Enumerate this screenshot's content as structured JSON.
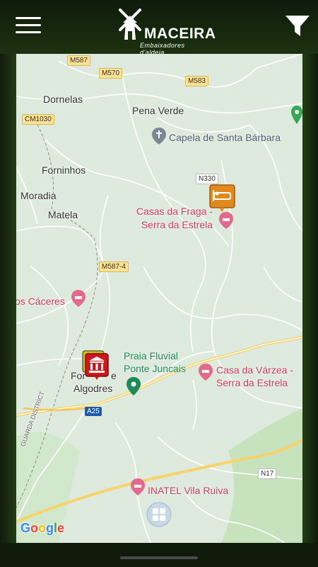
{
  "header": {
    "logo_text": "MACEIRA",
    "logo_subtitle": "Embaixadores d'aldeia",
    "menu_icon": "hamburger-menu-icon",
    "filter_icon": "filter-funnel-icon"
  },
  "map": {
    "places": {
      "dornelas": "Dornelas",
      "pena_verde": "Pena Verde",
      "forninhos": "Forninhos",
      "moradia": "Moradia",
      "matela": "Matela",
      "fornos_top": "For",
      "fornos_mid": "e",
      "algodres": "Algodres",
      "guarda_district": "GUARDA DISTRICT"
    },
    "roads": {
      "m587": "M587",
      "m570": "M570",
      "m583": "M583",
      "cm1030": "CM1030",
      "n330": "N330",
      "m587_4": "M587-4",
      "a25": "A25",
      "n17": "N17"
    },
    "pois": {
      "capela": "Capela de Santa Bárbara",
      "casas_fraga_1": "Casas da Fraga -",
      "casas_fraga_2": "Serra da Estrela",
      "os_caceres": "os Cáceres",
      "praia_1": "Praia Fluvial",
      "praia_2": "Ponte Juncais",
      "casa_varzea_1": "Casa da Várzea -",
      "casa_varzea_2": "Serra da Estrela",
      "inatel": "INATEL Vila Ruiva"
    },
    "google_logo": [
      "G",
      "o",
      "o",
      "g",
      "l",
      "e"
    ],
    "colors": {
      "poi_pink": "#d13b5d",
      "hotel_marker": "#e0891e",
      "museum_marker": "#d0151b",
      "park_green": "#1e8a55"
    }
  }
}
